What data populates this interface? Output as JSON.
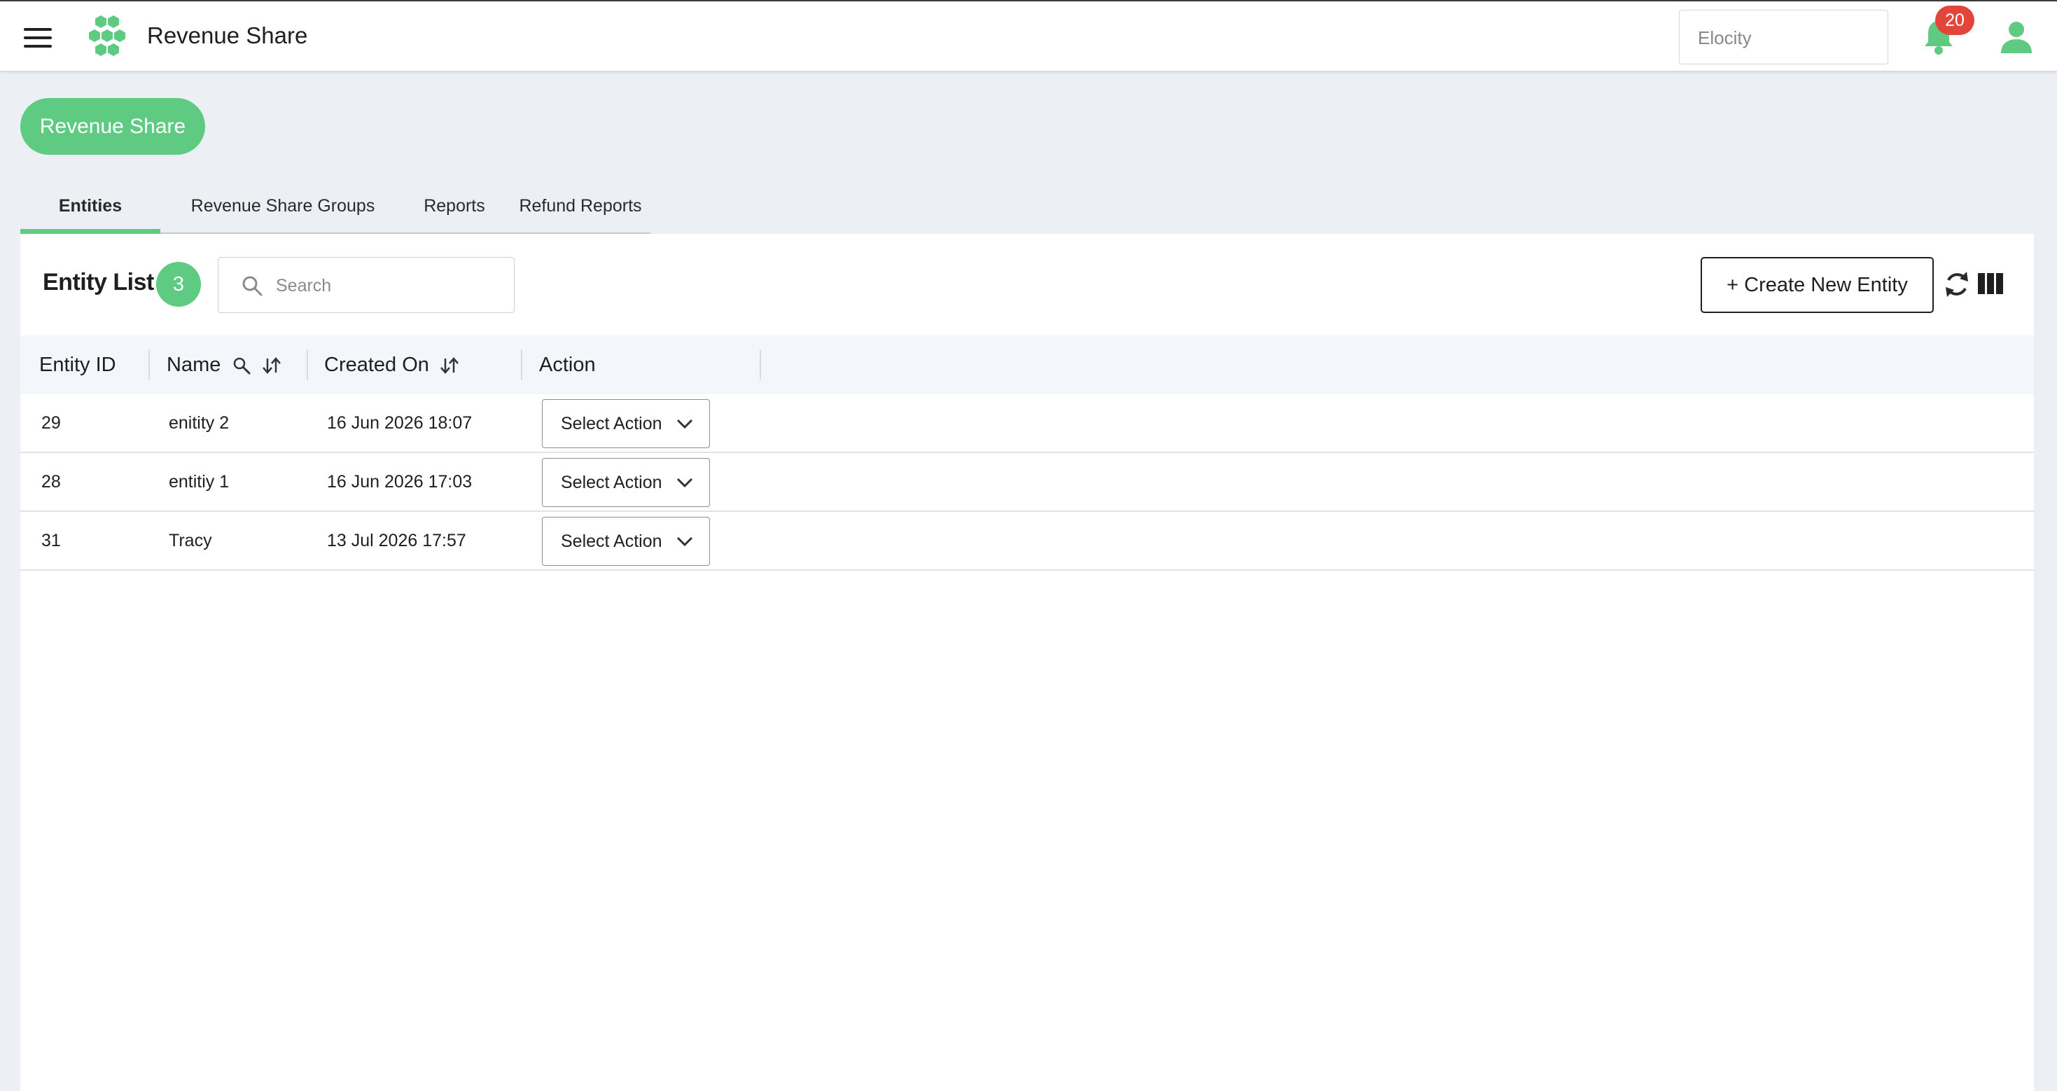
{
  "header": {
    "app_title": "Revenue Share",
    "org_selector_value": "Elocity",
    "notification_count": "20",
    "brand_color": "#5fcb82",
    "badge_color": "#e2463a"
  },
  "page": {
    "module_button": "Revenue Share",
    "tabs": [
      {
        "label": "Entities",
        "active": true
      },
      {
        "label": "Revenue Share Groups",
        "active": false
      },
      {
        "label": "Reports",
        "active": false
      },
      {
        "label": "Refund Reports",
        "active": false
      }
    ]
  },
  "entity_list": {
    "title": "Entity List",
    "count": "3",
    "search_placeholder": "Search",
    "create_button": "+ Create New Entity",
    "columns": [
      "Entity ID",
      "Name",
      "Created On",
      "Action"
    ],
    "rows": [
      {
        "id": "29",
        "name": "enitity 2",
        "created_on": "16 Jun 2026 18:07",
        "action": "Select Action"
      },
      {
        "id": "28",
        "name": "entitiy 1",
        "created_on": "16 Jun 2026 17:03",
        "action": "Select Action"
      },
      {
        "id": "31",
        "name": "Tracy",
        "created_on": "13 Jul 2026 17:57",
        "action": "Select Action"
      }
    ]
  },
  "icons": {
    "menu": "hamburger-menu-icon",
    "logo": "hexagon-cluster-logo",
    "notifications": "bell-icon",
    "user": "user-icon",
    "search": "search-icon",
    "refresh": "refresh-icon",
    "columns": "columns-icon",
    "sort": "sort-arrows-icon",
    "column_search": "magnifier-icon",
    "dropdown": "chevron-down-icon"
  }
}
